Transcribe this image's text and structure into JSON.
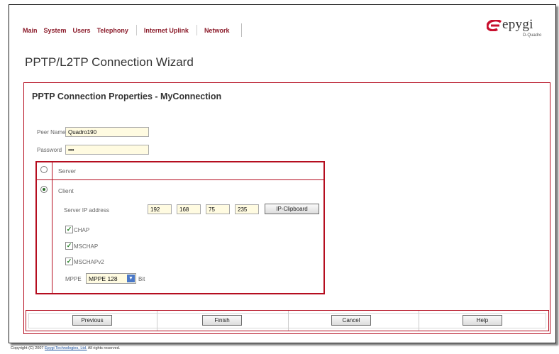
{
  "nav": {
    "items": [
      "Main",
      "System",
      "Users",
      "Telephony",
      "Internet Uplink",
      "Network"
    ]
  },
  "logo": {
    "word": "epygi",
    "sub": "D-Quadro",
    "icon": "epygi-logo-icon"
  },
  "page_title": "PPTP/L2TP Connection Wizard",
  "panel": {
    "title": "PPTP Connection Properties - MyConnection",
    "peer_name_label": "Peer Name",
    "peer_name_value": "Quadro190",
    "password_label": "Password",
    "password_value": "•••"
  },
  "mode": {
    "server_label": "Server",
    "client_label": "Client",
    "selected": "Client"
  },
  "client": {
    "server_ip_label": "Server IP address",
    "ip": [
      "192",
      "168",
      "75",
      "235"
    ],
    "clipboard_button": "IP-Clipboard",
    "chap_label": "CHAP",
    "mschap_label": "MSCHAP",
    "mschapv2_label": "MSCHAPv2",
    "chap_checked": true,
    "mschap_checked": true,
    "mschapv2_checked": true,
    "mppe_label": "MPPE",
    "mppe_value": "MPPE 128",
    "mppe_unit": "Bit"
  },
  "buttons": {
    "previous": "Previous",
    "finish": "Finish",
    "cancel": "Cancel",
    "help": "Help"
  },
  "footer": {
    "prefix": "Copyright (C) 2007",
    "link": "Epygi Technologies, Ltd.",
    "suffix": "All rights reserved."
  },
  "colors": {
    "accent": "#b50d1f",
    "nav_text": "#8b1b2a",
    "input_bg": "#fffbe1"
  }
}
